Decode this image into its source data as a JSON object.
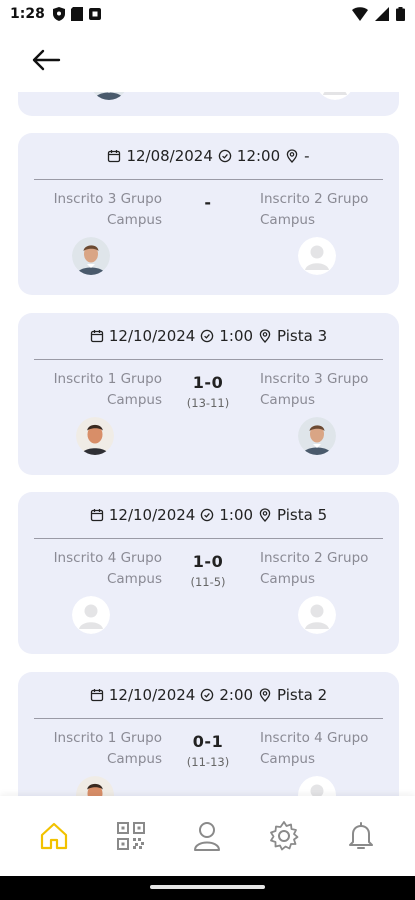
{
  "status_bar": {
    "time": "1:28"
  },
  "header": {
    "back_icon": "arrow-left-icon"
  },
  "matches": [
    {
      "date": "12/08/2024",
      "time": "12:00",
      "location": "-",
      "player_left": "Inscrito 3 Grupo Campus",
      "player_right": "Inscrito 2 Grupo Campus",
      "score": "-",
      "games": "",
      "avatar_left": "photo",
      "avatar_right": "placeholder"
    },
    {
      "date": "12/10/2024",
      "time": "1:00",
      "location": "Pista 3",
      "player_left": "Inscrito 1 Grupo Campus",
      "player_right": "Inscrito 3 Grupo Campus",
      "score": "1-0",
      "games": "(13-11)",
      "avatar_left": "photo",
      "avatar_right": "photo"
    },
    {
      "date": "12/10/2024",
      "time": "1:00",
      "location": "Pista 5",
      "player_left": "Inscrito 4 Grupo Campus",
      "player_right": "Inscrito 2 Grupo Campus",
      "score": "1-0",
      "games": "(11-5)",
      "avatar_left": "placeholder",
      "avatar_right": "placeholder"
    },
    {
      "date": "12/10/2024",
      "time": "2:00",
      "location": "Pista 2",
      "player_left": "Inscrito 1 Grupo Campus",
      "player_right": "Inscrito 4 Grupo Campus",
      "score": "0-1",
      "games": "(11-13)",
      "avatar_left": "photo",
      "avatar_right": "placeholder"
    }
  ],
  "bottom_nav": {
    "items": [
      "home-icon",
      "qr-code-icon",
      "profile-icon",
      "settings-icon",
      "notifications-icon"
    ],
    "active": "home-icon",
    "active_color": "#f2c200",
    "inactive_color": "#8a8a8a"
  },
  "colors": {
    "card_background": "#eceef9",
    "text_muted": "#8a8a94"
  }
}
